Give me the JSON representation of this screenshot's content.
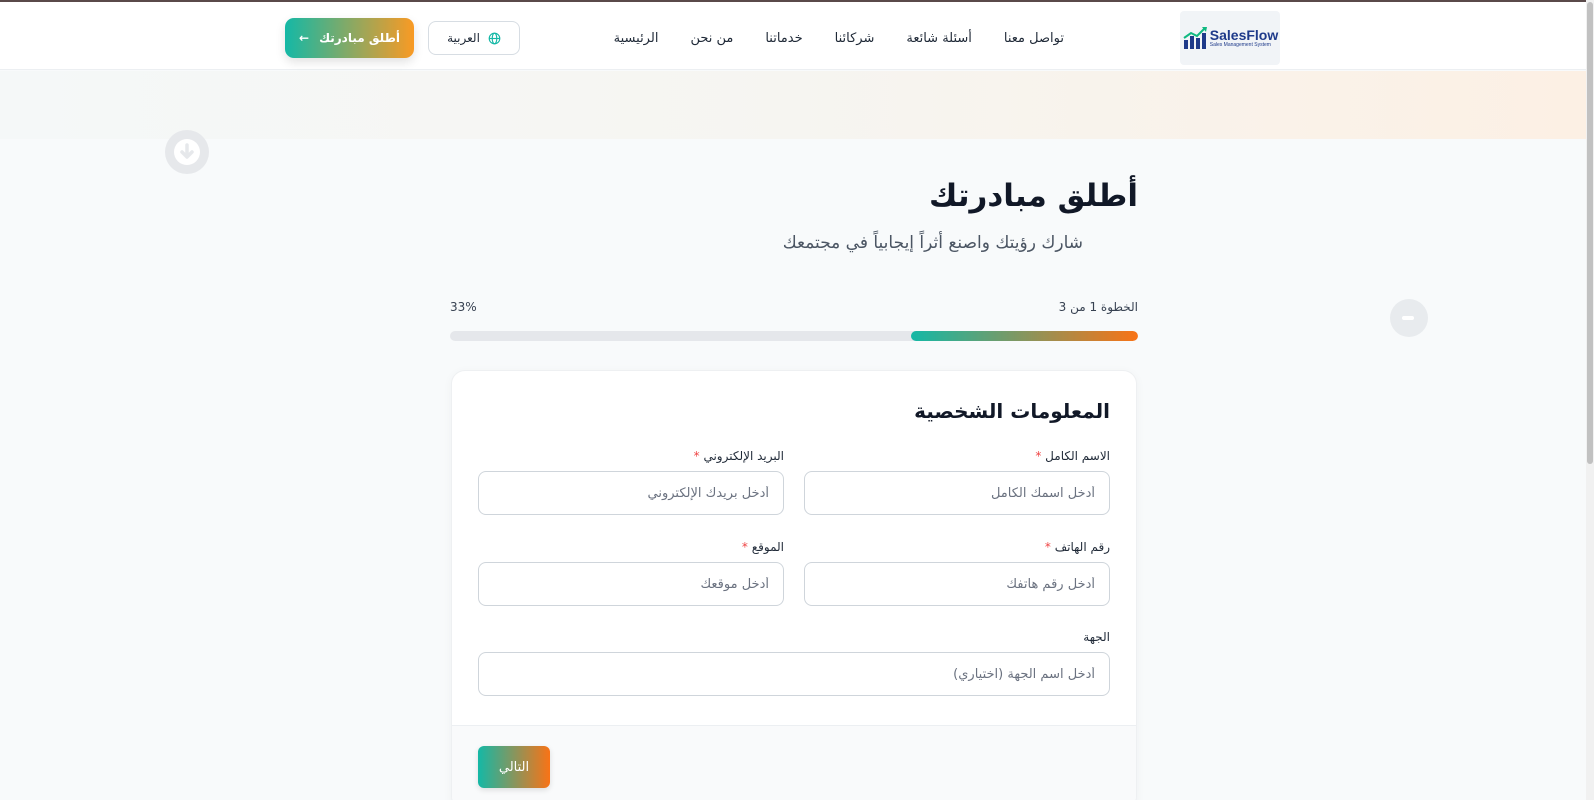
{
  "header": {
    "logo": {
      "name": "SalesFlow",
      "tagline": "Sales Management System"
    },
    "nav": [
      "تواصل معنا",
      "أسئلة شائعة",
      "شركائنا",
      "خدماتنا",
      "من نحن",
      "الرئيسية"
    ],
    "language_label": "العربية",
    "cta_label": "أطلق مبادرتك",
    "cta_arrow": "←"
  },
  "page": {
    "title": "أطلق مبادرتك",
    "subtitle": "شارك رؤيتك واصنع أثراً إيجابياً في مجتمعك"
  },
  "progress": {
    "step_label": "الخطوة 1 من 3",
    "percent_label": "33%",
    "value": 0.33
  },
  "form": {
    "section_title": "المعلومات الشخصية",
    "required_mark": "*",
    "fields": {
      "full_name": {
        "label": "الاسم الكامل",
        "placeholder": "أدخل اسمك الكامل",
        "value": ""
      },
      "email": {
        "label": "البريد الإلكتروني",
        "placeholder": "أدخل بريدك الإلكتروني",
        "value": ""
      },
      "phone": {
        "label": "رقم الهاتف",
        "placeholder": "أدخل رقم هاتفك",
        "value": ""
      },
      "location": {
        "label": "الموقع",
        "placeholder": "أدخل موقعك",
        "value": ""
      },
      "organization": {
        "label": "الجهة",
        "placeholder": "أدخل اسم الجهة (اختياري)",
        "value": ""
      }
    },
    "next_label": "التالي"
  },
  "colors": {
    "accent_start": "#14b8a6",
    "accent_end": "#f97316",
    "required": "#ef4444"
  },
  "icons": {
    "language": "globe-icon",
    "cta": "arrow-left-icon",
    "scroll_down": "arrow-down-circle-icon",
    "side_button": "circle-icon"
  }
}
